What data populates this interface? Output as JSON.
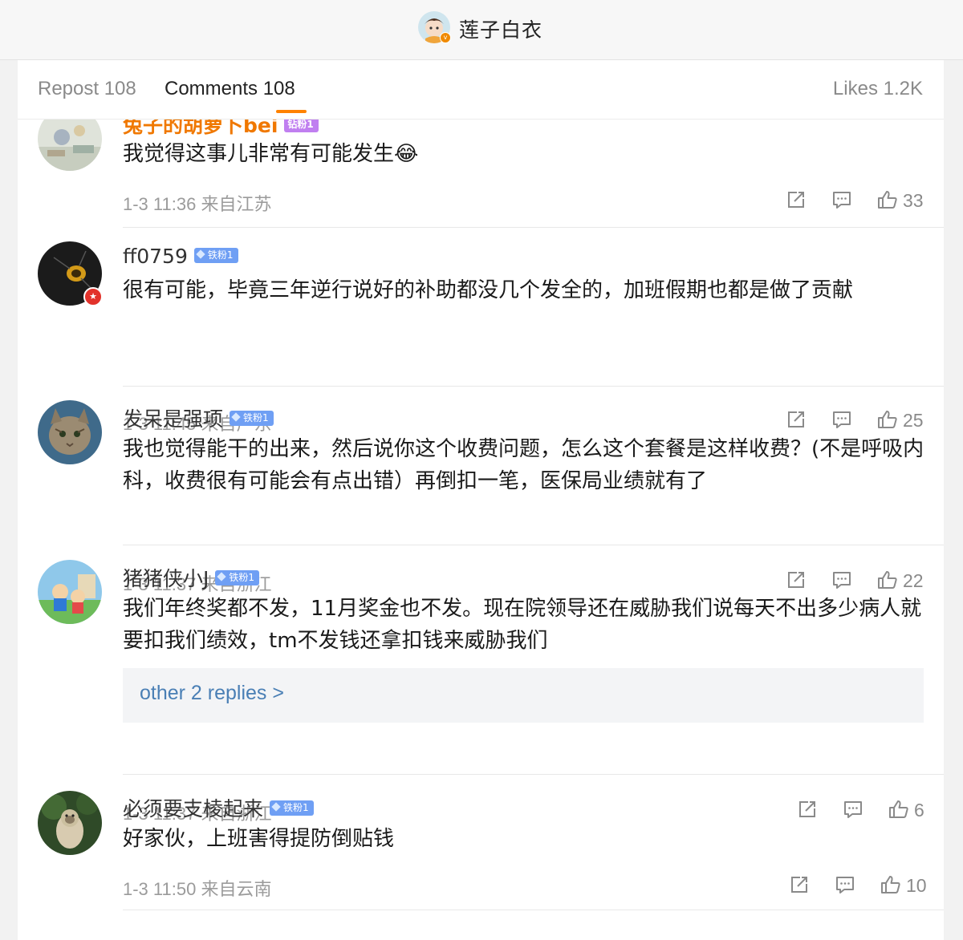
{
  "header": {
    "username": "莲子白衣",
    "badge": "v"
  },
  "tabs": {
    "repost": "Repost 108",
    "comments": "Comments 108",
    "likes": "Likes 1.2K"
  },
  "replies_link": "other 2 replies >",
  "comments": [
    {
      "name": "兔子的胡萝卜bei",
      "badge": "钻粉1",
      "text": "我觉得这事儿非常有可能发生",
      "emoji": "😂",
      "time": "1-3 11:36 来自江苏",
      "likes": "33"
    },
    {
      "name": "ff0759",
      "badge": "铁粉1",
      "text": "很有可能，毕竟三年逆行说好的补助都没几个发全的，加班假期也都是做了贡献",
      "time": "1-3 11:45 来自广东",
      "likes": "25"
    },
    {
      "name": "发呆是强项",
      "badge": "铁粉1",
      "text": "我也觉得能干的出来，然后说你这个收费问题，怎么这个套餐是这样收费？(不是呼吸内科，收费很有可能会有点出错）再倒扣一笔，医保局业绩就有了",
      "time": "1-3 11:37 来自浙江",
      "likes": "22"
    },
    {
      "name": "猪猪侠小J",
      "badge": "铁粉1",
      "text": "我们年终奖都不发，11月奖金也不发。现在院领导还在威胁我们说每天不出多少病人就要扣我们绩效，tm不发钱还拿扣钱来威胁我们",
      "time": "1-3 11:37 来自浙江",
      "likes": "6"
    },
    {
      "name": "必须要支棱起来",
      "badge": "铁粉1",
      "text": "好家伙，上班害得提防倒贴钱",
      "time": "1-3 11:50 来自云南",
      "likes": "10"
    }
  ],
  "colors": {
    "accent": "#ff8200",
    "link": "#4a7fb5",
    "name_highlight": "#f07800",
    "fan_badge": "#6f9ff4"
  }
}
